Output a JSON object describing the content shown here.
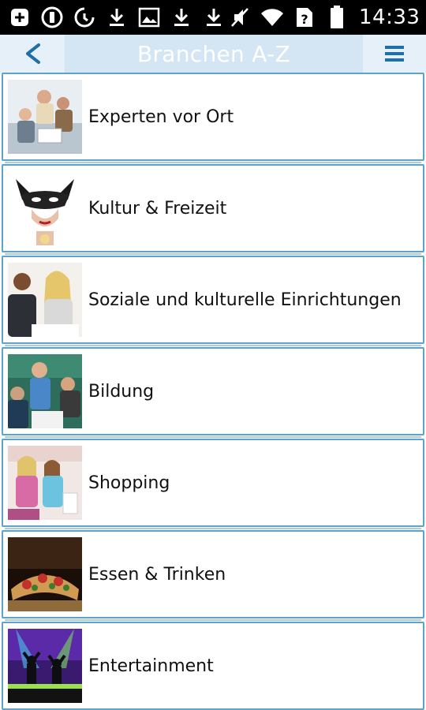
{
  "status_bar": {
    "time": "14:33",
    "icons": [
      "plus-box-icon",
      "alert-circle-icon",
      "sync-icon",
      "download-icon",
      "image-icon",
      "download-icon",
      "download-icon",
      "mute-icon",
      "wifi-icon",
      "no-sim-icon",
      "battery-icon"
    ]
  },
  "app_bar": {
    "back_label": "<",
    "title": "Branchen A-Z",
    "menu_icon": "hamburger-menu-icon"
  },
  "colors": {
    "accent": "#1e6fa6",
    "border": "#5fa3cc",
    "title_bg": "#d4e5f3",
    "app_bar_bg": "#e6f0f8"
  },
  "categories": [
    {
      "label": "Experten vor Ort",
      "icon": "business-meeting-thumbnail"
    },
    {
      "label": "Kultur & Freizeit",
      "icon": "masquerade-mask-thumbnail"
    },
    {
      "label": "Soziale und kulturelle Einrichtungen",
      "icon": "consultation-thumbnail"
    },
    {
      "label": "Bildung",
      "icon": "classroom-thumbnail"
    },
    {
      "label": "Shopping",
      "icon": "shopping-women-thumbnail"
    },
    {
      "label": "Essen & Trinken",
      "icon": "pizza-thumbnail"
    },
    {
      "label": "Entertainment",
      "icon": "concert-crowd-thumbnail"
    }
  ]
}
